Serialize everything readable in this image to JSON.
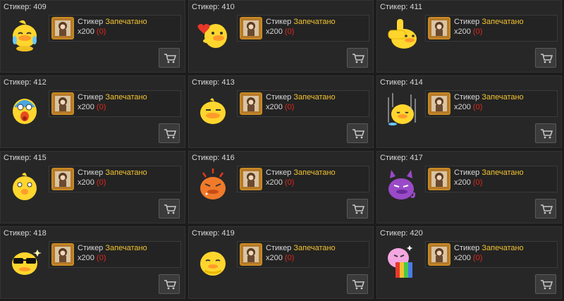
{
  "cards": [
    {
      "title": "Стикер: 409",
      "item_name": "Стикер",
      "item_status": "Запечатано",
      "qty": "x200",
      "count": "(0)",
      "icon": "crying-duck-icon"
    },
    {
      "title": "Стикер: 410",
      "item_name": "Стикер",
      "item_status": "Запечатано",
      "qty": "x200",
      "count": "(0)",
      "icon": "heart-duck-icon"
    },
    {
      "title": "Стикер: 411",
      "item_name": "Стикер",
      "item_status": "Запечатано",
      "qty": "x200",
      "count": "(0)",
      "icon": "thumbs-up-duck-icon"
    },
    {
      "title": "Стикер: 412",
      "item_name": "Стикер",
      "item_status": "Запечатано",
      "qty": "x200",
      "count": "(0)",
      "icon": "screaming-duck-icon"
    },
    {
      "title": "Стикер: 413",
      "item_name": "Стикер",
      "item_status": "Запечатано",
      "qty": "x200",
      "count": "(0)",
      "icon": "smug-duck-icon"
    },
    {
      "title": "Стикер: 414",
      "item_name": "Стикер",
      "item_status": "Запечатано",
      "qty": "x200",
      "count": "(0)",
      "icon": "sad-rain-duck-icon"
    },
    {
      "title": "Стикер: 415",
      "item_name": "Стикер",
      "item_status": "Запечатано",
      "qty": "x200",
      "count": "(0)",
      "icon": "surprised-duck-icon"
    },
    {
      "title": "Стикер: 416",
      "item_name": "Стикер",
      "item_status": "Запечатано",
      "qty": "x200",
      "count": "(0)",
      "icon": "angry-duck-icon"
    },
    {
      "title": "Стикер: 417",
      "item_name": "Стикер",
      "item_status": "Запечатано",
      "qty": "x200",
      "count": "(0)",
      "icon": "devil-duck-icon"
    },
    {
      "title": "Стикер: 418",
      "item_name": "Стикер",
      "item_status": "Запечатано",
      "qty": "x200",
      "count": "(0)",
      "icon": "sunglasses-duck-icon"
    },
    {
      "title": "Стикер: 419",
      "item_name": "Стикер",
      "item_status": "Запечатано",
      "qty": "x200",
      "count": "(0)",
      "icon": "shy-duck-icon"
    },
    {
      "title": "Стикер: 420",
      "item_name": "Стикер",
      "item_status": "Запечатано",
      "qty": "x200",
      "count": "(0)",
      "icon": "rainbow-duck-icon"
    }
  ],
  "colors": {
    "background": "#1c1c1c",
    "card": "#272727",
    "status": "#f2c230",
    "count": "#e0281e",
    "duck": "#ffd62e"
  }
}
